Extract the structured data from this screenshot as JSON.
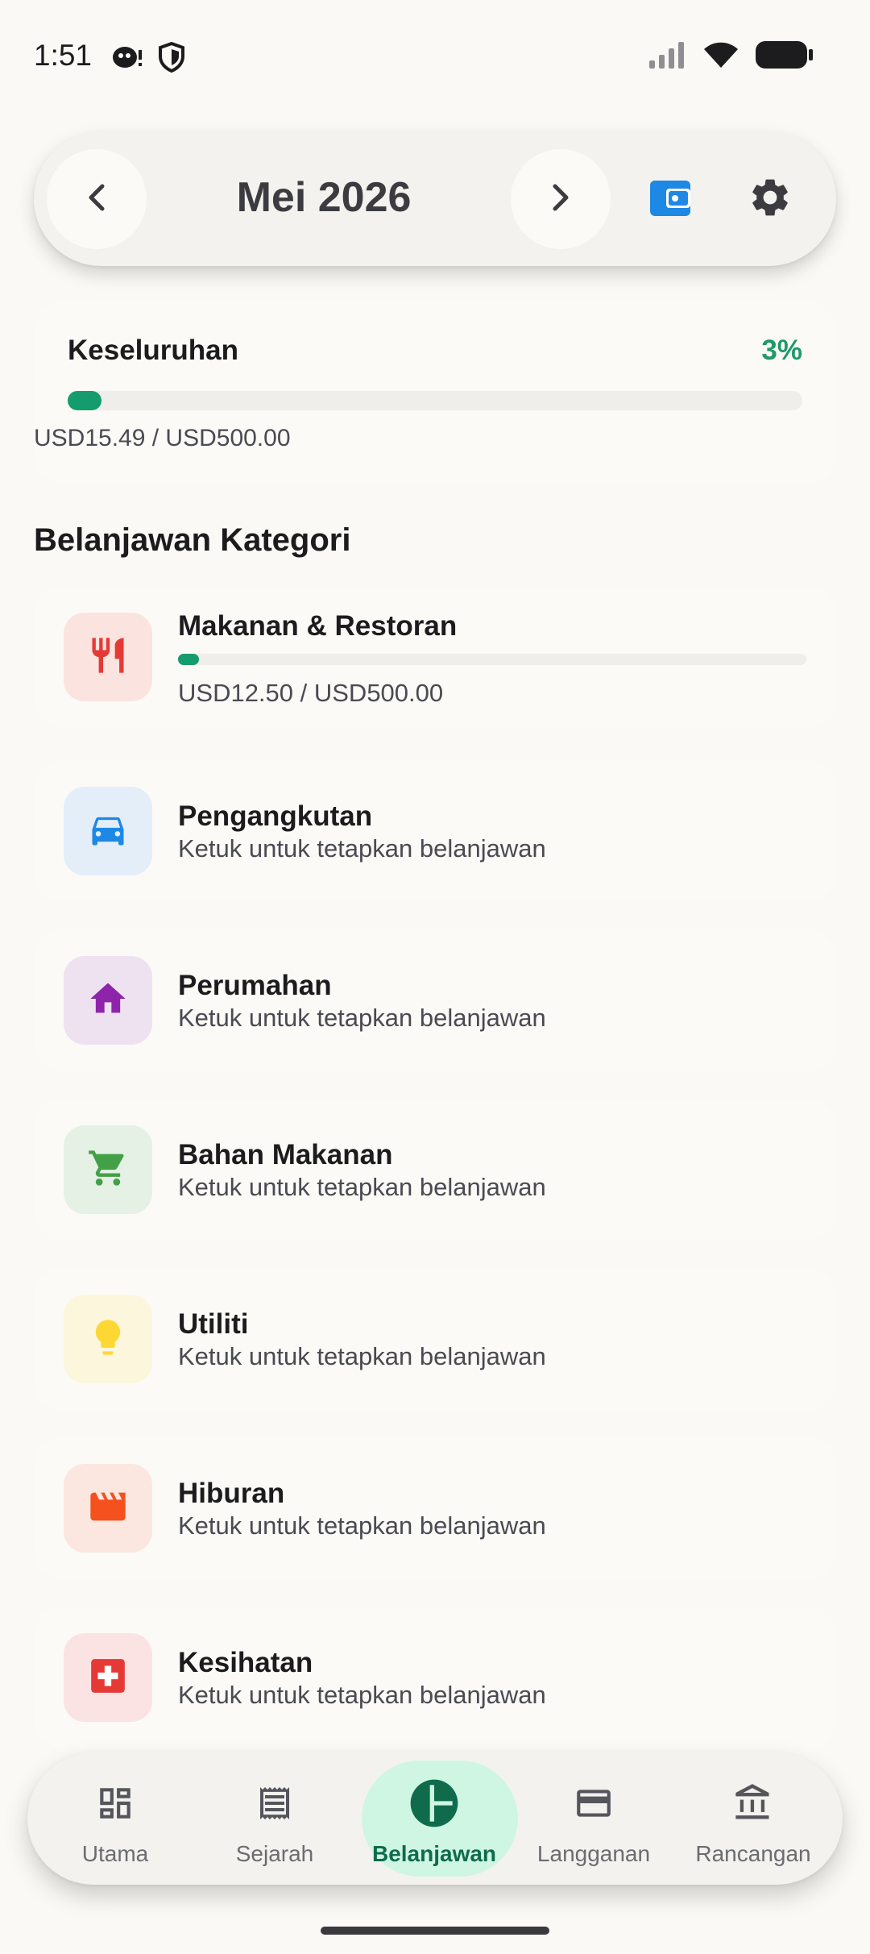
{
  "status_bar": {
    "time": "1:51"
  },
  "header": {
    "month_title": "Mei 2026",
    "prev_icon": "chevron-left-icon",
    "next_icon": "chevron-right-icon",
    "wallet_icon": "wallet-icon",
    "settings_icon": "gear-icon"
  },
  "overall": {
    "label": "Keseluruhan",
    "percent": "3%",
    "progress_fraction": 0.031,
    "amount": "USD15.49 / USD500.00"
  },
  "section_title": "Belanjawan Kategori",
  "categories": [
    {
      "name": "Makanan & Restoran",
      "amount": "USD12.50 / USD500.00",
      "progress_fraction": 0.025,
      "icon": "restaurant-icon",
      "bg": "#FBE3DF",
      "color": "#E53935"
    },
    {
      "name": "Pengangkutan",
      "subtitle": "Ketuk untuk tetapkan belanjawan",
      "icon": "car-icon",
      "bg": "#E3EEF9",
      "color": "#1E88E5"
    },
    {
      "name": "Perumahan",
      "subtitle": "Ketuk untuk tetapkan belanjawan",
      "icon": "home-icon",
      "bg": "#EEE2F1",
      "color": "#8E24AA"
    },
    {
      "name": "Bahan Makanan",
      "subtitle": "Ketuk untuk tetapkan belanjawan",
      "icon": "cart-icon",
      "bg": "#E5F1E4",
      "color": "#43A047"
    },
    {
      "name": "Utiliti",
      "subtitle": "Ketuk untuk tetapkan belanjawan",
      "icon": "lightbulb-icon",
      "bg": "#FCF6DC",
      "color": "#FDD835"
    },
    {
      "name": "Hiburan",
      "subtitle": "Ketuk untuk tetapkan belanjawan",
      "icon": "movie-icon",
      "bg": "#FCE7E0",
      "color": "#F4511E"
    },
    {
      "name": "Kesihatan",
      "subtitle": "Ketuk untuk tetapkan belanjawan",
      "icon": "medical-icon",
      "bg": "#FBE3E3",
      "color": "#E53935"
    }
  ],
  "bottom_nav": {
    "items": [
      {
        "label": "Utama",
        "icon": "dashboard-icon"
      },
      {
        "label": "Sejarah",
        "icon": "receipt-icon"
      },
      {
        "label": "Belanjawan",
        "icon": "pie-chart-icon",
        "active": true
      },
      {
        "label": "Langganan",
        "icon": "credit-card-icon"
      },
      {
        "label": "Rancangan",
        "icon": "bank-icon"
      }
    ]
  },
  "colors": {
    "accent": "#159C6E",
    "percent_text": "#1E9A68",
    "active_pill": "#CFF6E2",
    "background": "#FAF9F5"
  }
}
